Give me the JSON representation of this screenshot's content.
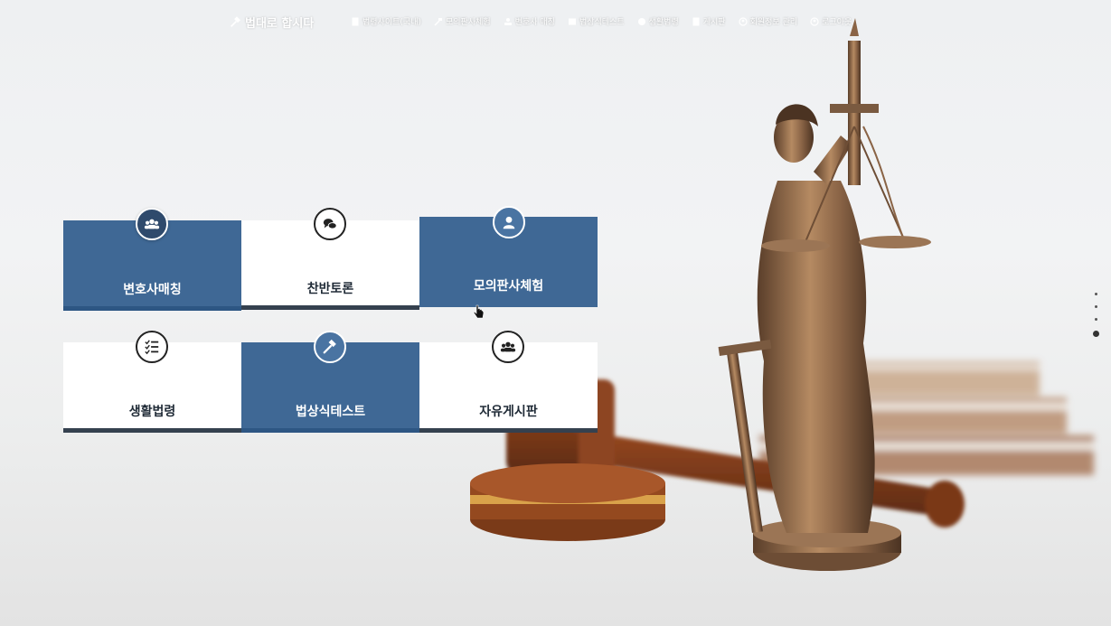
{
  "brand": {
    "logo_text": "법대로 합시다",
    "accent": "#3f6895",
    "dark_bar": "#35414f"
  },
  "nav": {
    "items": [
      {
        "label": "법령사이트(국내)",
        "icon": "document-icon"
      },
      {
        "label": "모의판사체험",
        "icon": "gavel-icon"
      },
      {
        "label": "변호사 매칭",
        "icon": "users-icon"
      },
      {
        "label": "법상식테스트",
        "icon": "book-icon"
      },
      {
        "label": "생활법령",
        "icon": "globe-icon"
      },
      {
        "label": "게시판",
        "icon": "list-icon"
      },
      {
        "label": "회원정보 관리",
        "icon": "user-icon"
      },
      {
        "label": "로그아웃",
        "icon": "user-icon"
      }
    ]
  },
  "cards": [
    {
      "label": "변호사매칭",
      "icon": "users-icon",
      "style": "blue"
    },
    {
      "label": "찬반토론",
      "icon": "chat-icon",
      "style": "white"
    },
    {
      "label": "모의판사체험",
      "icon": "user-icon",
      "style": "blue"
    },
    {
      "label": "생활법령",
      "icon": "checklist-icon",
      "style": "white"
    },
    {
      "label": "법상식테스트",
      "icon": "gavel-icon",
      "style": "blue"
    },
    {
      "label": "자유게시판",
      "icon": "users-icon",
      "style": "white"
    }
  ],
  "pager": {
    "count": 4,
    "active_index": 3
  }
}
